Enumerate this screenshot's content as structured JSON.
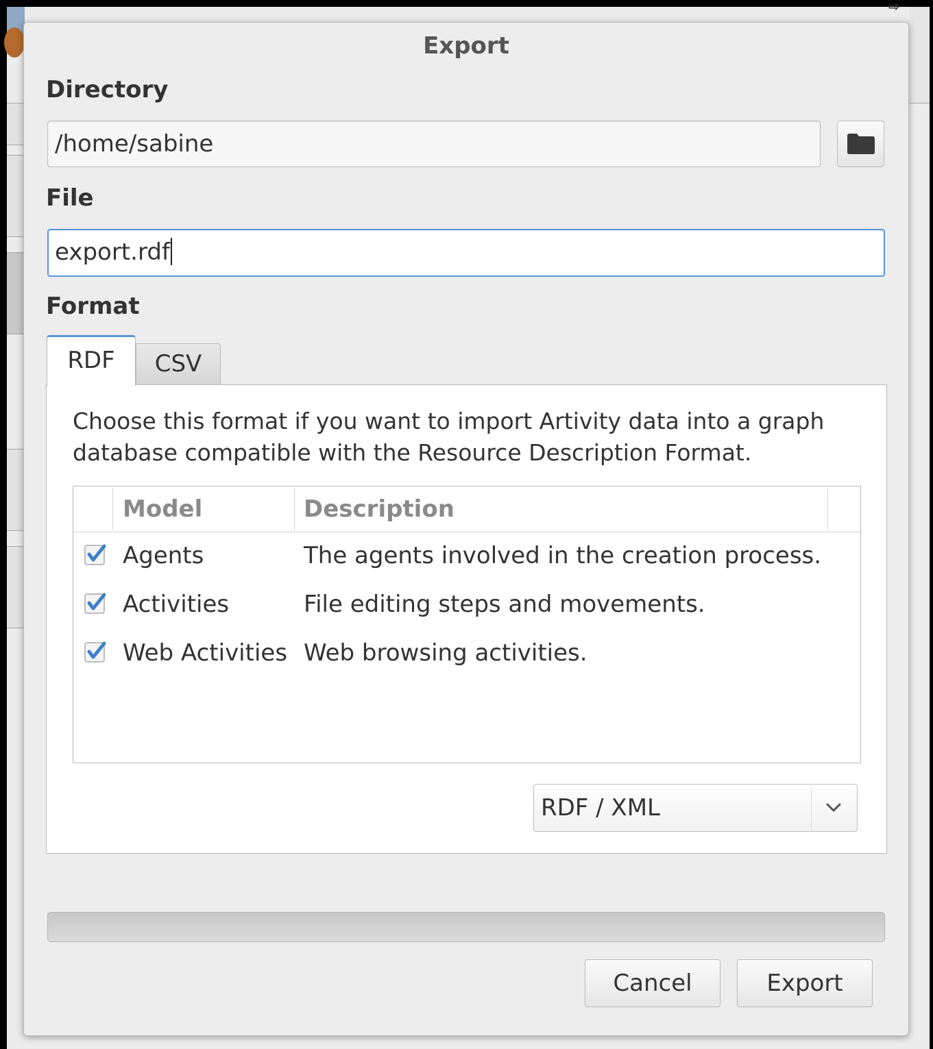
{
  "dialog": {
    "title": "Export"
  },
  "directory": {
    "label": "Directory",
    "value": "/home/sabine",
    "browse_icon": "folder-icon"
  },
  "file": {
    "label": "File",
    "value": "export.rdf"
  },
  "format": {
    "label": "Format",
    "tabs": [
      {
        "label": "RDF",
        "active": true
      },
      {
        "label": "CSV",
        "active": false
      }
    ],
    "description": "Choose this format if you want to import Artivity data into a graph database compatible with the Resource Description Format.",
    "table": {
      "columns": [
        "Model",
        "Description"
      ],
      "rows": [
        {
          "checked": true,
          "model": "Agents",
          "description": "The agents involved in the creation process."
        },
        {
          "checked": true,
          "model": "Activities",
          "description": "File editing steps and movements."
        },
        {
          "checked": true,
          "model": "Web Activities",
          "description": "Web browsing activities."
        }
      ]
    },
    "serialization": {
      "selected": "RDF / XML",
      "icon": "chevron-down-icon"
    }
  },
  "progress": {
    "value": 0
  },
  "buttons": {
    "cancel": "Cancel",
    "export": "Export"
  },
  "colors": {
    "accent": "#5b96d8",
    "dialog_bg": "#ededed",
    "check": "#3d7fc8"
  }
}
